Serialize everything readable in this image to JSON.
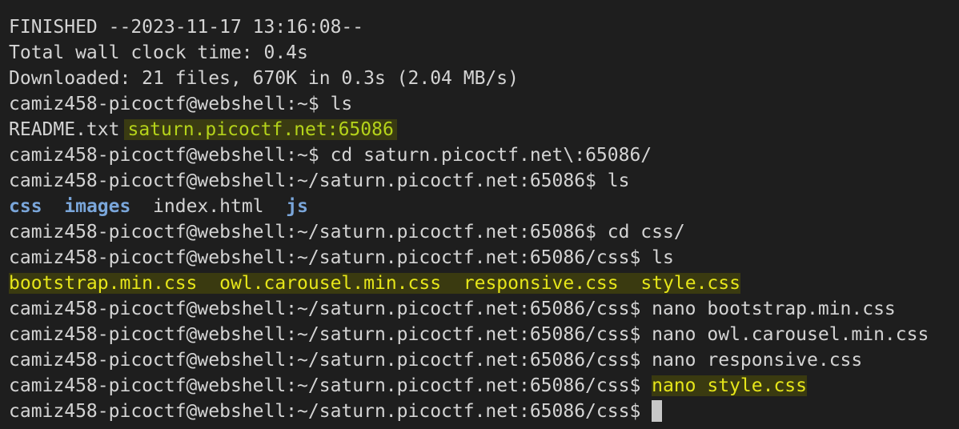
{
  "terminal": {
    "line_finished": "FINISHED --2023-11-17 13:16:08--",
    "line_wall": "Total wall clock time: 0.4s",
    "line_downloaded": "Downloaded: 21 files, 670K in 0.3s (2.04 MB/s)",
    "prompt_home": "camiz458-picoctf@webshell:~$ ",
    "prompt_site": "camiz458-picoctf@webshell:~/saturn.picoctf.net:65086$ ",
    "prompt_css": "camiz458-picoctf@webshell:~/saturn.picoctf.net:65086/css$ ",
    "cmd_ls": "ls",
    "cmd_cd_site": "cd saturn.picoctf.net\\:65086/",
    "cmd_cd_css": "cd css/",
    "cmd_nano_bootstrap": "nano bootstrap.min.css",
    "cmd_nano_owl": "nano owl.carousel.min.css",
    "cmd_nano_responsive": "nano responsive.css",
    "cmd_nano_style": "nano style.css",
    "ls_home": {
      "readme": "README.txt",
      "site_dir": "saturn.picoctf.net:65086"
    },
    "ls_site": {
      "css": "css",
      "images": "images",
      "index": "index.html",
      "js": "js"
    },
    "ls_css": {
      "bootstrap": "bootstrap.min.css",
      "owl": "owl.carousel.min.css",
      "responsive": "responsive.css",
      "style": "style.css"
    },
    "colors": {
      "background": "#1e1e1e",
      "text": "#d4d4d4",
      "directory": "#7aa6da",
      "highlight_green": "#b5d31a",
      "highlight_yellow": "#e6e61a"
    }
  }
}
